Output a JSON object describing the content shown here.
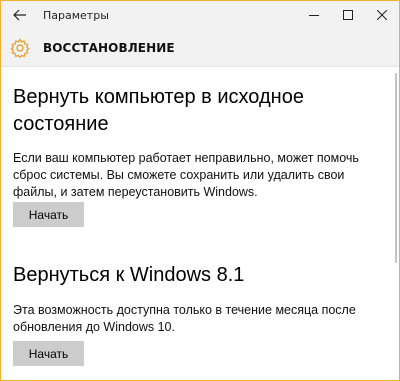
{
  "window": {
    "title": "Параметры",
    "accent": "#f0b030"
  },
  "icons": {
    "back": "back-arrow-icon",
    "minimize": "minimize-icon",
    "maximize": "maximize-icon",
    "close": "close-icon",
    "page": "gear-icon"
  },
  "page": {
    "title": "ВОССТАНОВЛЕНИЕ",
    "icon_color": "#e8a33b"
  },
  "sections": [
    {
      "title": "Вернуть компьютер в исходное состояние",
      "text": "Если ваш компьютер работает неправильно, может помочь сброс системы. Вы сможете сохранить или удалить свои файлы, и затем переустановить Windows.",
      "button": "Начать"
    },
    {
      "title": "Вернуться к Windows 8.1",
      "text": "Эта возможность доступна только в течение месяца после обновления до Windows 10.",
      "button": "Начать"
    }
  ]
}
